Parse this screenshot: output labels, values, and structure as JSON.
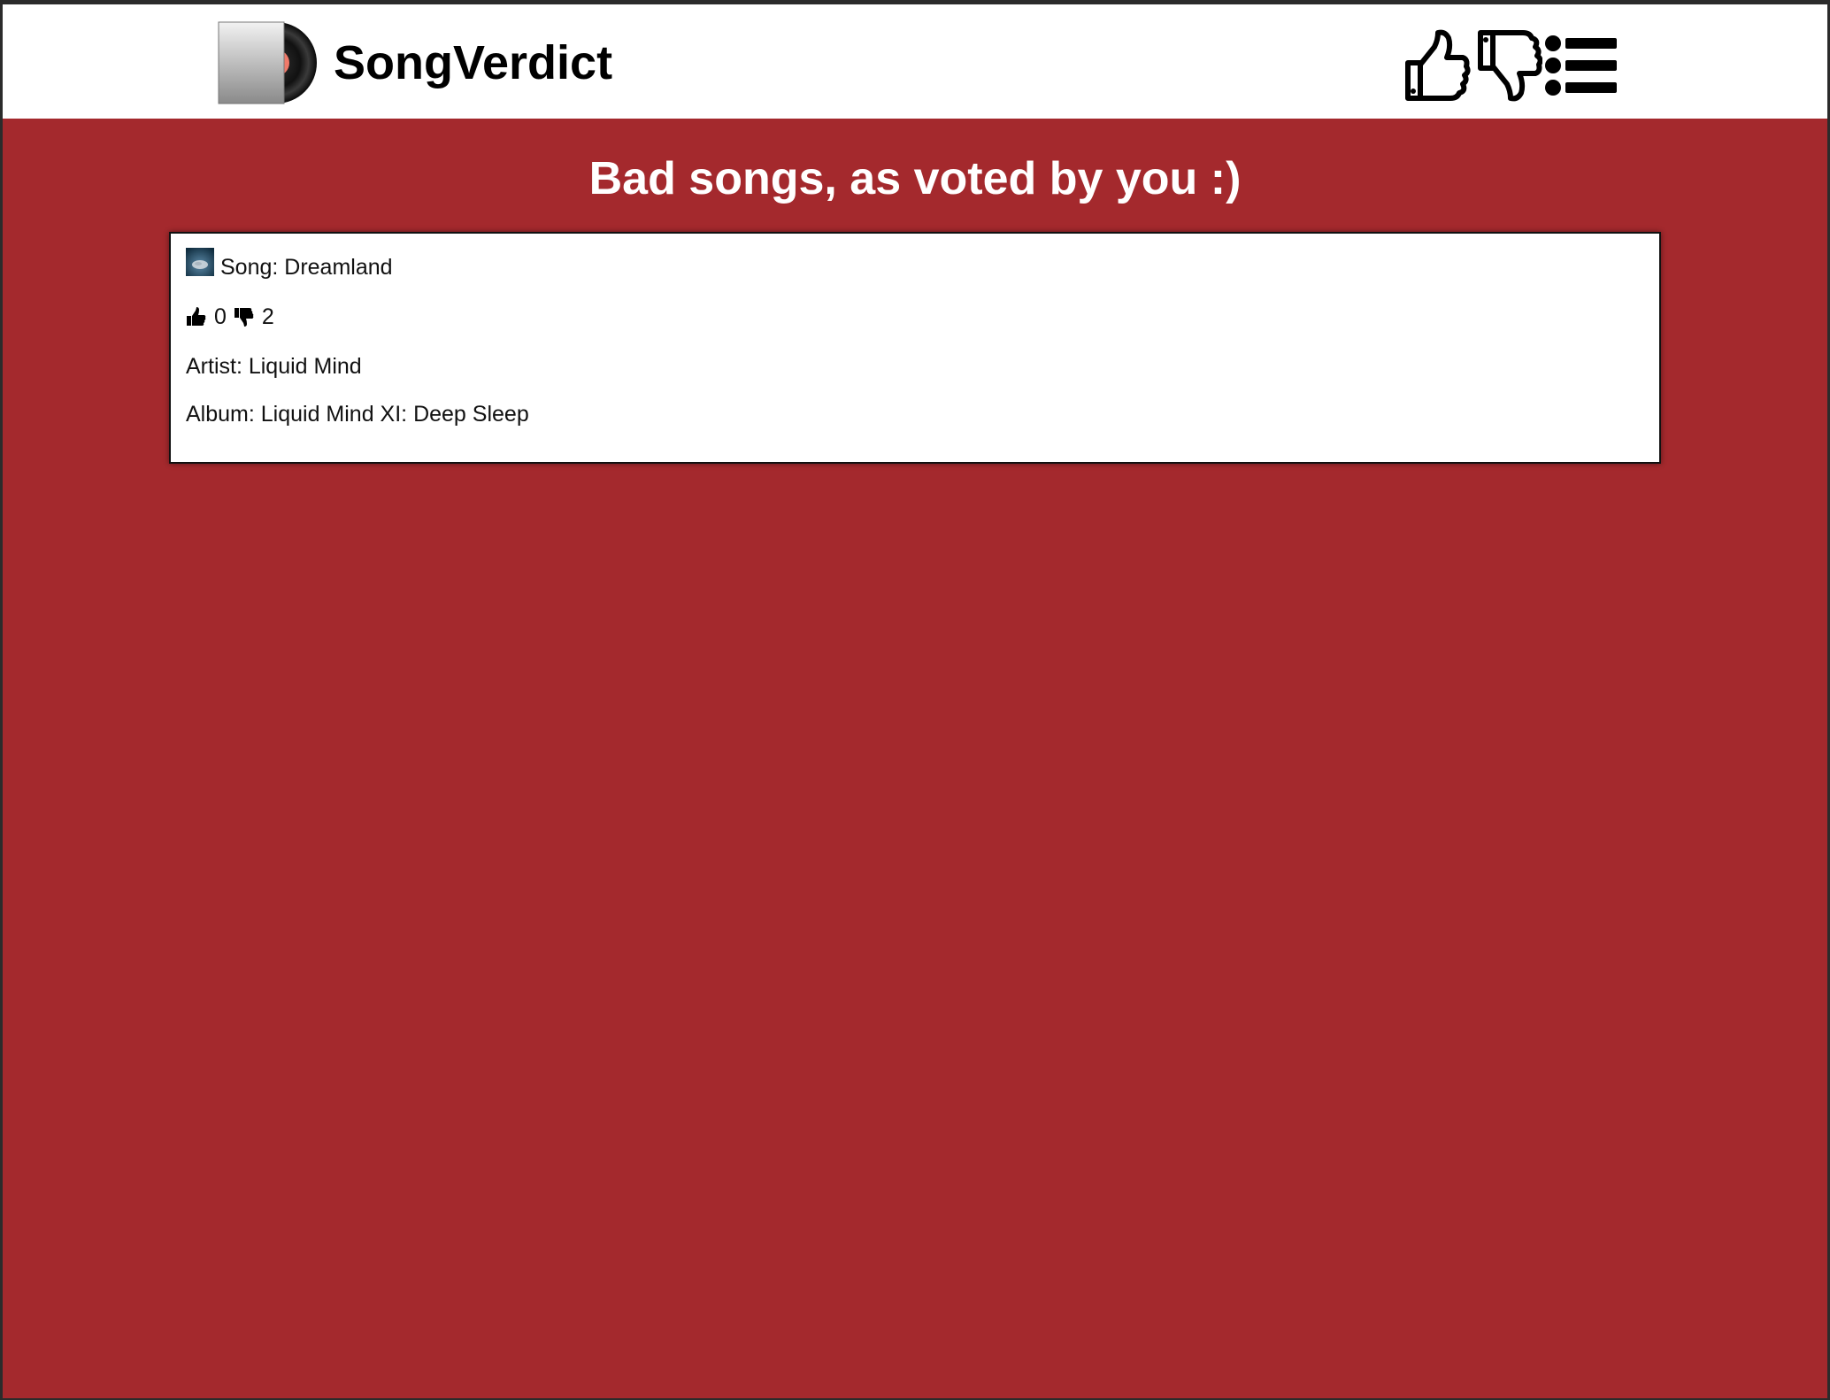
{
  "app": {
    "brand": "SongVerdict",
    "colors": {
      "background": "#a4292d",
      "topbar": "#ffffff",
      "text_on_bg": "#ffffff"
    },
    "nav": [
      {
        "icon": "thumbs-up-icon"
      },
      {
        "icon": "thumbs-down-icon"
      },
      {
        "icon": "list-icon"
      }
    ]
  },
  "main": {
    "title": "Bad songs, as voted by you :)",
    "songs": [
      {
        "song_label": "Song: Dreamland",
        "upvotes": "0",
        "downvotes": "2",
        "artist_label": "Artist: Liquid Mind",
        "album_label": "Album: Liquid Mind XI: Deep Sleep"
      }
    ]
  }
}
